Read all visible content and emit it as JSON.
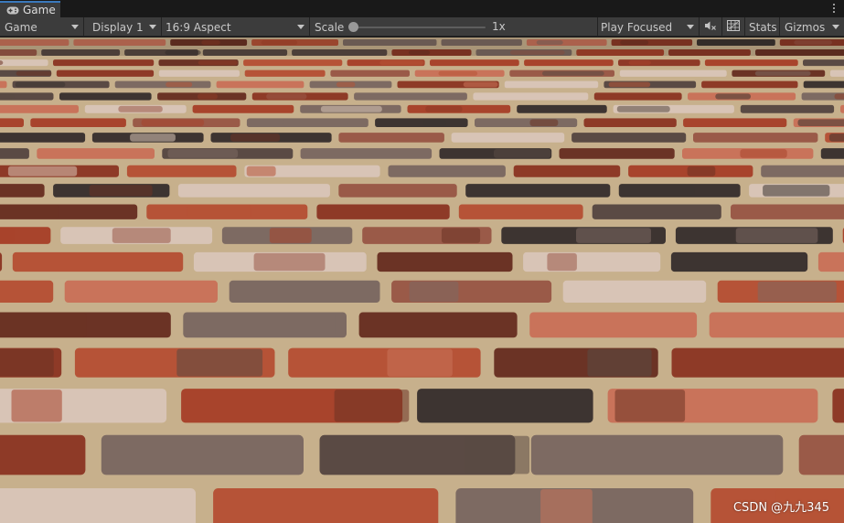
{
  "window": {
    "tab_label": "Game",
    "tab_icon": "gamepad-icon"
  },
  "toolbar": {
    "view_mode": "Game",
    "display": "Display 1",
    "aspect": "16:9 Aspect",
    "scale_label": "Scale",
    "scale_value": "1x",
    "scale_fraction": 0.0,
    "play_mode": "Play Focused",
    "stats_label": "Stats",
    "gizmos_label": "Gizmos"
  },
  "viewport": {
    "watermark": "CSDN @九九345"
  },
  "colors": {
    "accent": "#3a79bb",
    "toolbar_bg": "#3c3c3c",
    "tab_bg": "#191919",
    "mortar": "#c9b392",
    "brick_red": "#a8442c",
    "brick_dark": "#3d3431"
  }
}
